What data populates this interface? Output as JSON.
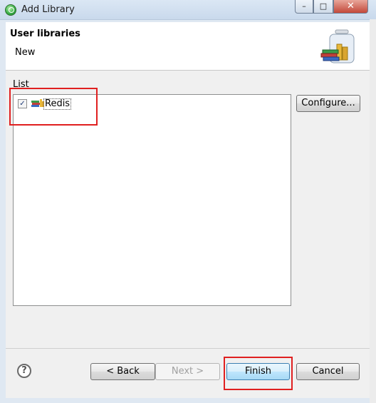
{
  "window": {
    "title": "Add Library",
    "controls": {
      "minimize": "–",
      "maximize": "□",
      "close": "✕"
    }
  },
  "header": {
    "title": "User libraries",
    "subtitle": "New",
    "icon": "library-jar-icon"
  },
  "list": {
    "label": "List",
    "items": [
      {
        "label": "Redis",
        "checked": true,
        "icon": "user-library-icon"
      }
    ]
  },
  "buttons": {
    "configure": "Configure...",
    "back": "< Back",
    "next": "Next >",
    "finish": "Finish",
    "cancel": "Cancel"
  },
  "help": {
    "glyph": "?"
  },
  "colors": {
    "highlight": "#e02020",
    "default_button": "#3c7fb1"
  }
}
